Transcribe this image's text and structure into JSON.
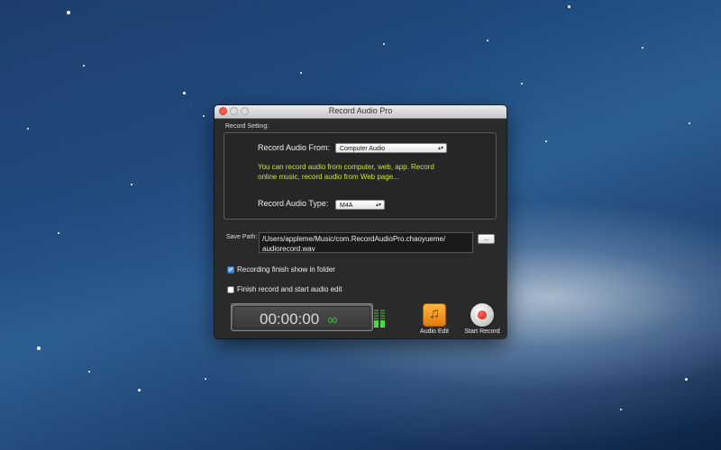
{
  "window": {
    "title": "Record Audio Pro"
  },
  "record_setting": {
    "section_label": "Record Setting:",
    "source_label": "Record Audio From:",
    "source_value": "Computer Audio",
    "hint_line1": "You can record audio from computer, web, app. Record",
    "hint_line2": "online music, record audio from Web page...",
    "type_label": "Record Audio Type:",
    "type_value": "M4A"
  },
  "save": {
    "label": "Save Path:",
    "path_line1": "/Users/appleme/Music/com.RecordAudioPro.chaoyueme/",
    "path_line2": "audiorecord.wav",
    "browse_label": "..."
  },
  "options": [
    {
      "label": "Recording finish show in folder",
      "checked": true
    },
    {
      "label": "Finish record and start audio edit",
      "checked": false
    }
  ],
  "timer": {
    "time": "00:00:00",
    "frames": "00"
  },
  "toolbar": {
    "audio_edit_label": "Audio Edit",
    "start_record_label": "Start Record"
  },
  "colors": {
    "hint": "#c8e63a",
    "frames": "#3bdb3b",
    "close_button": "#f25a52"
  }
}
